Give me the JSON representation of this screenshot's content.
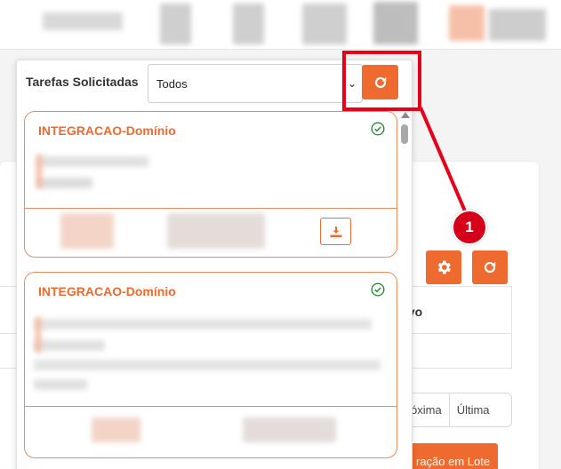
{
  "panel": {
    "title": "Tarefas Solicitadas",
    "filter_value": "Todos"
  },
  "tasks": [
    {
      "title": "INTEGRACAO-Domínio",
      "status": "completed"
    },
    {
      "title": "INTEGRACAO-Domínio",
      "status": "completed"
    }
  ],
  "background": {
    "table_header_partial": "ivo",
    "pager": {
      "next": "Próxima",
      "last": "Última"
    },
    "batch_button_partial": "ração em Lote"
  },
  "annotation": {
    "step": "1"
  },
  "colors": {
    "accent": "#ef6a2e",
    "annotation": "#e8001a",
    "success": "#2e8b3a"
  },
  "icons": [
    "refresh-icon",
    "gear-icon",
    "check-circle-icon",
    "download-icon",
    "chevron-down-icon"
  ]
}
